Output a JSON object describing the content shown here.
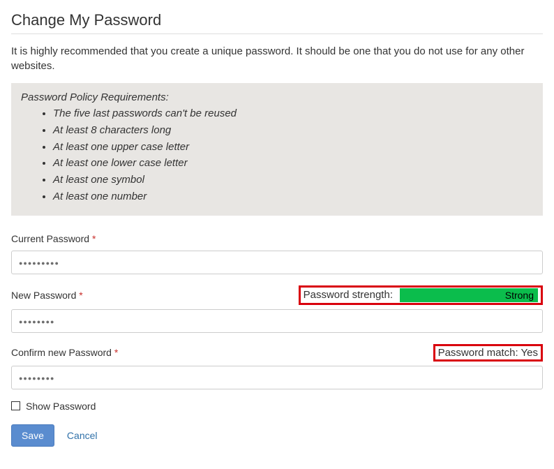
{
  "title": "Change My Password",
  "intro": "It is highly recommended that you create a unique password. It should be one that you do not use for any other websites.",
  "policy": {
    "heading": "Password Policy Requirements:",
    "items": [
      "The five last passwords can't be reused",
      "At least 8 characters long",
      "At least one upper case letter",
      "At least one lower case letter",
      "At least one symbol",
      "At least one number"
    ]
  },
  "fields": {
    "current": {
      "label": "Current Password",
      "mask": "●●●●●●●●●"
    },
    "new": {
      "label": "New Password",
      "mask": "●●●●●●●●",
      "strength_label": "Password strength:",
      "strength_value": "Strong"
    },
    "confirm": {
      "label": "Confirm new Password",
      "mask": "●●●●●●●●",
      "match_text": "Password match: Yes"
    }
  },
  "required_mark": "*",
  "show_password_label": "Show Password",
  "buttons": {
    "save": "Save",
    "cancel": "Cancel"
  }
}
